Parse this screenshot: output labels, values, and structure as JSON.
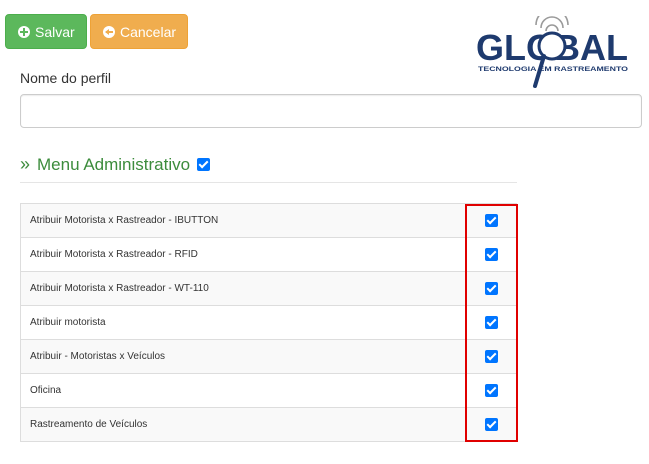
{
  "toolbar": {
    "save_label": "Salvar",
    "cancel_label": "Cancelar",
    "save_icon": "plus-circle-icon",
    "cancel_icon": "arrow-left-circle-icon"
  },
  "logo": {
    "name": "GLOBAL",
    "tagline": "TECNOLOGIA EM RASTREAMENTO"
  },
  "profile": {
    "name_label": "Nome do perfil",
    "name_value": "",
    "name_placeholder": ""
  },
  "section": {
    "prefix": "»",
    "title": "Menu Administrativo",
    "checked": true
  },
  "permissions": [
    {
      "label": "Atribuir Motorista x Rastreador - IBUTTON",
      "checked": true
    },
    {
      "label": "Atribuir Motorista x Rastreador - RFID",
      "checked": true
    },
    {
      "label": "Atribuir Motorista x Rastreador - WT-110",
      "checked": true
    },
    {
      "label": "Atribuir motorista",
      "checked": true
    },
    {
      "label": "Atribuir - Motoristas x Veículos",
      "checked": true
    },
    {
      "label": "Oficina",
      "checked": true
    },
    {
      "label": "Rastreamento de Veículos",
      "checked": true
    }
  ],
  "colors": {
    "save": "#5cb85c",
    "cancel": "#f0ad4e",
    "section_title": "#3c8c3c",
    "checkbox": "#0075ff",
    "highlight": "#e00000",
    "logo_navy": "#1e3a6e"
  }
}
